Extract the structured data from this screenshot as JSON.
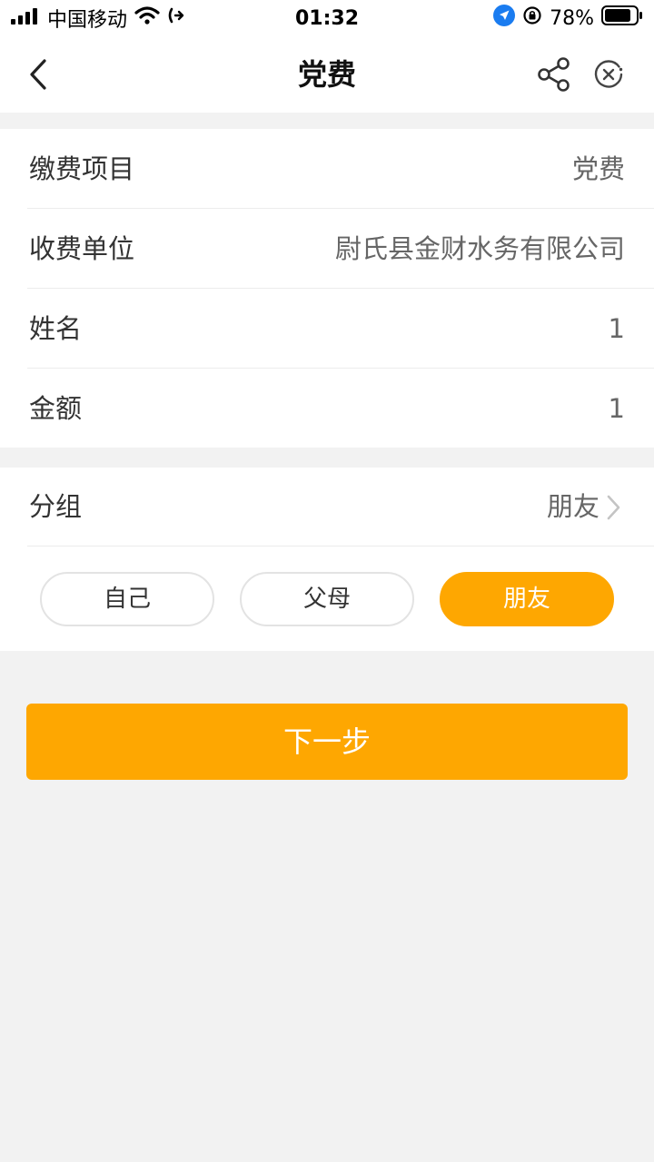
{
  "status_bar": {
    "carrier": "中国移动",
    "time": "01:32",
    "battery": "78%"
  },
  "nav": {
    "title": "党费",
    "icons": [
      "back-icon",
      "share-icon",
      "close-circle-icon"
    ]
  },
  "payment_info": {
    "item_label": "缴费项目",
    "item_value": "党费",
    "payee_label": "收费单位",
    "payee_value": "尉氏县金财水务有限公司",
    "name_label": "姓名",
    "name_value": "1",
    "amount_label": "金额",
    "amount_value": "1"
  },
  "group": {
    "label": "分组",
    "value": "朋友",
    "options": [
      "自己",
      "父母",
      "朋友"
    ],
    "selected": "朋友"
  },
  "next_button": "下一步",
  "colors": {
    "accent": "#fea701",
    "background": "#f2f2f2"
  }
}
